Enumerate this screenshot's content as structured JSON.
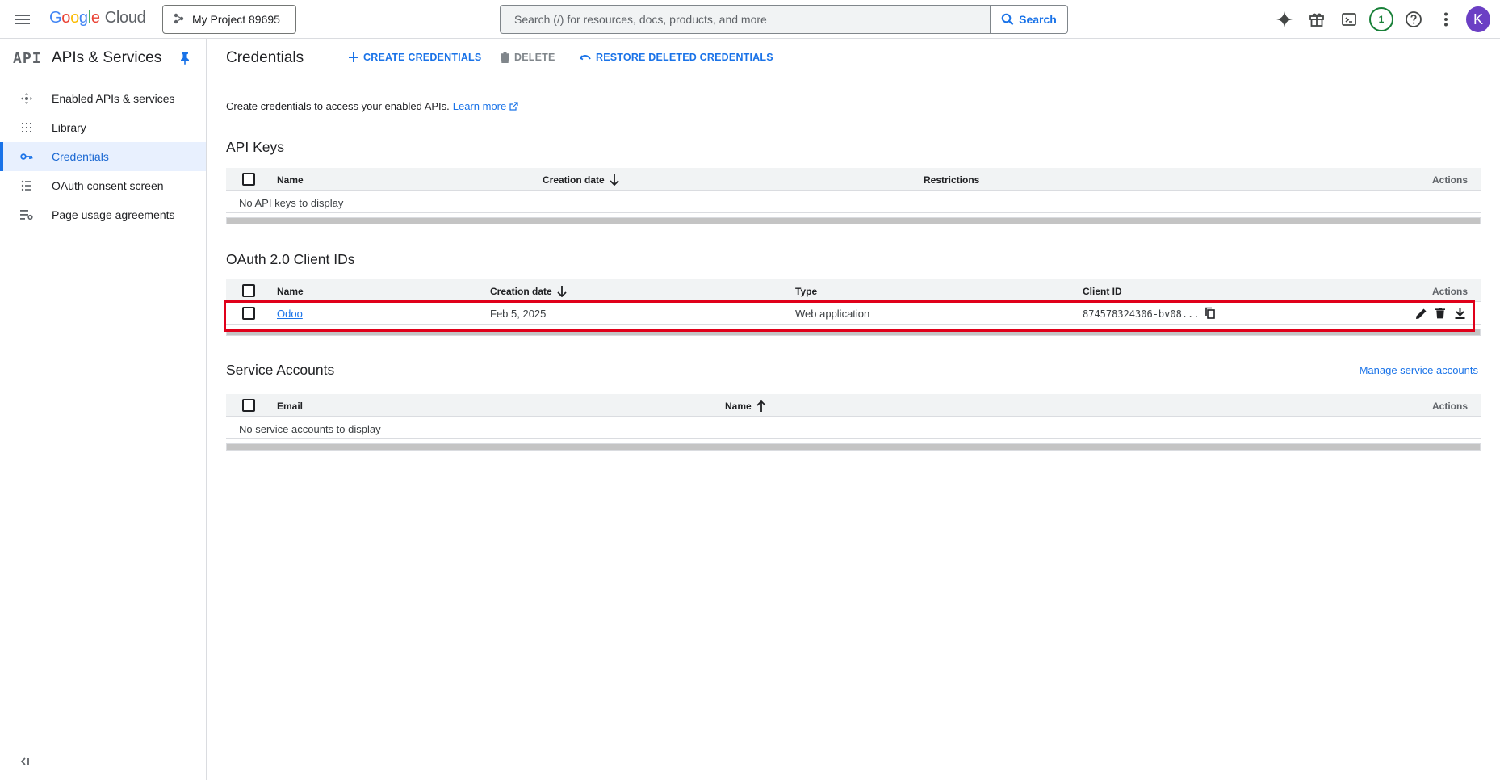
{
  "header": {
    "logo_letters": [
      "G",
      "o",
      "o",
      "g",
      "l",
      "e"
    ],
    "logo_cloud": "Cloud",
    "project_name": "My Project 89695",
    "search_placeholder": "Search (/) for resources, docs, products, and more",
    "search_button": "Search",
    "notification_count": "1",
    "avatar_initial": "K"
  },
  "sidebar": {
    "logo": "API",
    "title": "APIs & Services",
    "items": [
      {
        "label": "Enabled APIs & services",
        "icon": "enabled-apis-icon",
        "active": false
      },
      {
        "label": "Library",
        "icon": "library-icon",
        "active": false
      },
      {
        "label": "Credentials",
        "icon": "key-icon",
        "active": true
      },
      {
        "label": "OAuth consent screen",
        "icon": "oauth-consent-icon",
        "active": false
      },
      {
        "label": "Page usage agreements",
        "icon": "page-usage-icon",
        "active": false
      }
    ]
  },
  "main": {
    "title": "Credentials",
    "actions": {
      "create": "CREATE CREDENTIALS",
      "delete": "DELETE",
      "restore": "RESTORE DELETED CREDENTIALS"
    },
    "intro_text": "Create credentials to access your enabled APIs.",
    "learn_more": "Learn more",
    "api_keys": {
      "title": "API Keys",
      "columns": {
        "name": "Name",
        "creation_date": "Creation date",
        "restrictions": "Restrictions",
        "actions": "Actions"
      },
      "empty": "No API keys to display"
    },
    "oauth": {
      "title": "OAuth 2.0 Client IDs",
      "columns": {
        "name": "Name",
        "creation_date": "Creation date",
        "type": "Type",
        "client_id": "Client ID",
        "actions": "Actions"
      },
      "rows": [
        {
          "name": "Odoo",
          "creation_date": "Feb 5, 2025",
          "type": "Web application",
          "client_id": "874578324306-bv08..."
        }
      ]
    },
    "service_accounts": {
      "title": "Service Accounts",
      "manage_link": "Manage service accounts",
      "columns": {
        "email": "Email",
        "name": "Name",
        "actions": "Actions"
      },
      "empty": "No service accounts to display"
    }
  },
  "colors": {
    "accent": "#1a73e8",
    "highlight": "#e0001a",
    "avatar": "#6b3fc4",
    "notification": "#188038"
  }
}
